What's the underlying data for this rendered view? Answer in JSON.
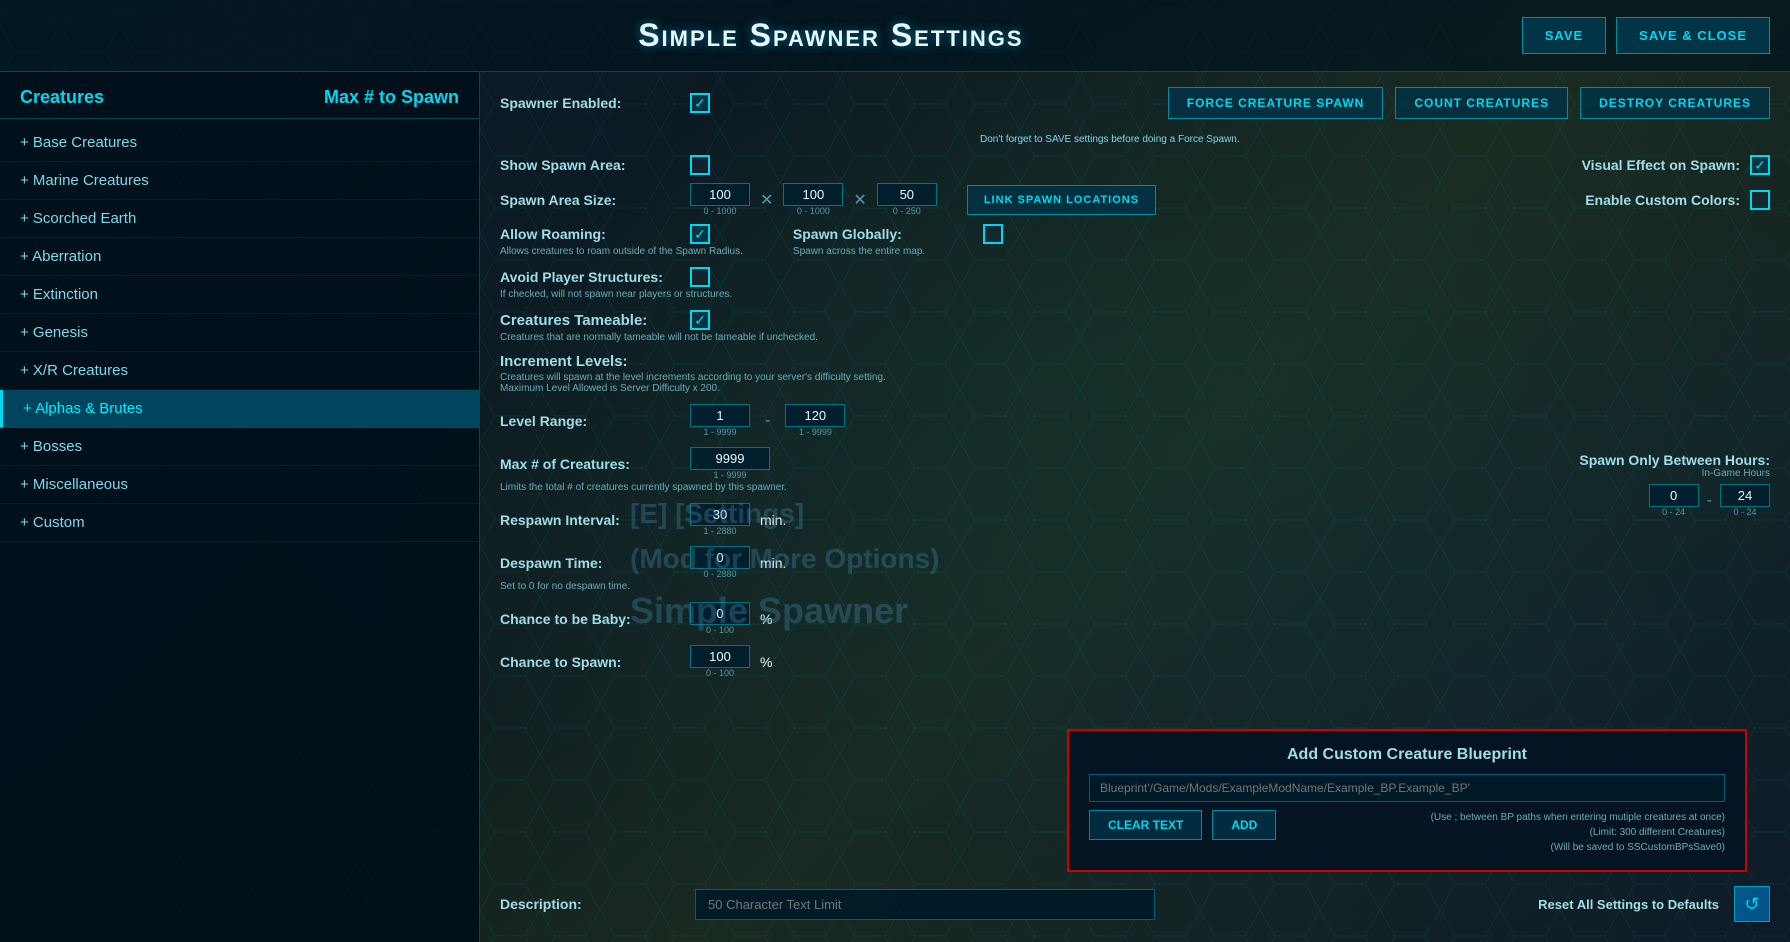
{
  "header": {
    "title": "Simple Spawner Settings",
    "save_label": "SAVE",
    "save_close_label": "SAVE & CLOSE"
  },
  "sidebar": {
    "creatures_label": "Creatures",
    "max_spawn_label": "Max # to Spawn",
    "items": [
      {
        "id": "base",
        "label": "+ Base Creatures",
        "active": false
      },
      {
        "id": "marine",
        "label": "+ Marine Creatures",
        "active": false
      },
      {
        "id": "scorched",
        "label": "+ Scorched Earth",
        "active": false
      },
      {
        "id": "aberration",
        "label": "+ Aberration",
        "active": false
      },
      {
        "id": "extinction",
        "label": "+ Extinction",
        "active": false
      },
      {
        "id": "genesis",
        "label": "+ Genesis",
        "active": false
      },
      {
        "id": "xr",
        "label": "+ X/R Creatures",
        "active": false
      },
      {
        "id": "alphas",
        "label": "+ Alphas & Brutes",
        "active": true
      },
      {
        "id": "bosses",
        "label": "+ Bosses",
        "active": false
      },
      {
        "id": "misc",
        "label": "+ Miscellaneous",
        "active": false
      },
      {
        "id": "custom",
        "label": "+ Custom",
        "active": false
      }
    ]
  },
  "actions": {
    "force_spawn_label": "FORCE CREATURE SPAWN",
    "count_creatures_label": "COUNT CREATURES",
    "destroy_creatures_label": "DESTROY CREATURES",
    "force_spawn_note": "Don't forget to SAVE settings before doing a Force Spawn."
  },
  "settings": {
    "spawner_enabled_label": "Spawner Enabled:",
    "spawner_enabled": true,
    "show_spawn_area_label": "Show Spawn Area:",
    "show_spawn_area": false,
    "spawn_area_size_label": "Spawn Area Size:",
    "spawn_x": "100",
    "spawn_y": "100",
    "spawn_z": "50",
    "spawn_x_range": "0 - 1000",
    "spawn_y_range": "0 - 1000",
    "spawn_z_range": "0 - 250",
    "allow_roaming_label": "Allow Roaming:",
    "allow_roaming": true,
    "allow_roaming_note": "Allows creatures to roam outside of the Spawn Radius.",
    "spawn_globally_label": "Spawn Globally:",
    "spawn_globally": false,
    "spawn_globally_note": "Spawn across the entire map.",
    "avoid_structures_label": "Avoid Player Structures:",
    "avoid_structures": false,
    "avoid_structures_note": "If checked, will not spawn near players or structures.",
    "creatures_tameable_label": "Creatures Tameable:",
    "creatures_tameable": true,
    "creatures_tameable_note": "Creatures that are normally tameable will not be tameable if unchecked.",
    "increment_levels_label": "Increment Levels:",
    "increment_levels_note": "Creatures will spawn at the level increments according to your server's difficulty setting. Maximum Level Allowed is Server Difficulty x 200.",
    "level_range_label": "Level Range:",
    "level_min": "1",
    "level_max": "120",
    "level_min_range": "1 - 9999",
    "level_max_range": "1 - 9999",
    "max_creatures_label": "Max # of Creatures:",
    "max_creatures": "9999",
    "max_creatures_range": "1 - 9999",
    "max_creatures_note": "Limits the total # of creatures currently spawned by this spawner.",
    "respawn_interval_label": "Respawn Interval:",
    "respawn_value": "30",
    "respawn_unit": "min.",
    "respawn_range": "1 - 2880",
    "despawn_time_label": "Despawn Time:",
    "despawn_value": "0",
    "despawn_unit": "min.",
    "despawn_range": "0 - 2880",
    "despawn_note": "Set to 0 for no despawn time.",
    "chance_baby_label": "Chance to be Baby:",
    "chance_baby_value": "0",
    "chance_baby_unit": "%",
    "chance_baby_range": "0 - 100",
    "chance_spawn_label": "Chance to Spawn:",
    "chance_spawn_value": "100",
    "chance_spawn_unit": "%",
    "chance_spawn_range": "0 - 100",
    "visual_effect_label": "Visual Effect on Spawn:",
    "visual_effect": true,
    "custom_colors_label": "Enable Custom Colors:",
    "custom_colors": false,
    "link_spawn_label": "LINK SPAWN LOCATIONS",
    "spawn_hours_label": "Spawn Only Between Hours:",
    "spawn_hours_sub": "In-Game Hours",
    "spawn_hour_start": "0",
    "spawn_hour_end": "24",
    "spawn_hour_range": "0 - 24"
  },
  "watermark": {
    "line1": "[E] [Settings]",
    "line2": "(Mod for More Options)",
    "line3": "Simple Spawner"
  },
  "custom_bp": {
    "title": "Add Custom Creature Blueprint",
    "placeholder": "Blueprint'/Game/Mods/ExampleModName/Example_BP.Example_BP'",
    "clear_label": "Clear Text",
    "add_label": "ADD",
    "note1": "(Use ; between BP paths when entering mutiple creatures at once)",
    "note2": "(Limit: 300 different Creatures)",
    "note3": "(Will be saved to SSCustomBPsSave0)"
  },
  "description": {
    "label": "Description:",
    "placeholder": "50 Character Text Limit",
    "reset_label": "Reset All Settings to Defaults",
    "reset_icon": "↺"
  }
}
